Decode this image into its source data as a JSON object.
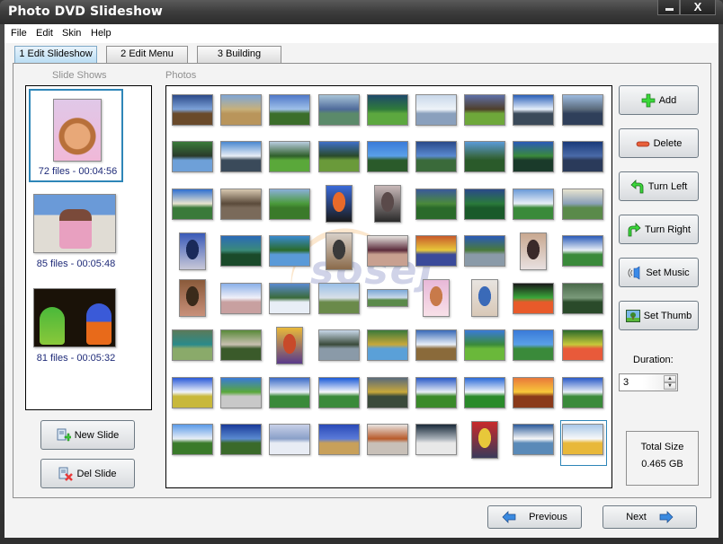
{
  "window": {
    "title": "Photo DVD Slideshow",
    "minimize_label": "",
    "close_label": "X"
  },
  "menu": {
    "items": [
      {
        "label": "File"
      },
      {
        "label": "Edit"
      },
      {
        "label": "Skin"
      },
      {
        "label": "Help"
      }
    ]
  },
  "tabs": [
    {
      "label": "1 Edit Slideshow",
      "active": true
    },
    {
      "label": "2 Edit Menu",
      "active": false
    },
    {
      "label": "3 Building",
      "active": false
    }
  ],
  "slideshows": {
    "heading": "Slide Shows",
    "items": [
      {
        "caption": "72 files - 00:04:56",
        "thumb": "girl-portrait",
        "selected": true
      },
      {
        "caption": "85 files - 00:05:48",
        "thumb": "couple-beach",
        "selected": false
      },
      {
        "caption": "81 files - 00:05:32",
        "thumb": "parrots",
        "selected": false
      }
    ],
    "new_slide_label": "New Slide",
    "del_slide_label": "Del Slide"
  },
  "photos": {
    "heading": "Photos",
    "watermark": "sosej",
    "selected_index": 71,
    "items": [
      {
        "subject": "windmill-field",
        "orient": "h",
        "colors": [
          "#2b4a8a",
          "#7da2d8",
          "#6a4a2a"
        ]
      },
      {
        "subject": "dry-field",
        "orient": "h",
        "colors": [
          "#7fa6d6",
          "#c7b07a",
          "#b9955b"
        ]
      },
      {
        "subject": "green-field-sky",
        "orient": "h",
        "colors": [
          "#4f78c9",
          "#9fc0e8",
          "#3b6e2a"
        ]
      },
      {
        "subject": "bridge",
        "orient": "h",
        "colors": [
          "#a8c4d8",
          "#4e6a9a",
          "#5b8a6a"
        ]
      },
      {
        "subject": "hill-tree",
        "orient": "h",
        "colors": [
          "#1e4a6a",
          "#2f7a3a",
          "#5ca83f"
        ]
      },
      {
        "subject": "snow-landscape",
        "orient": "h",
        "colors": [
          "#c9d8ea",
          "#eef3f8",
          "#8aa0bd"
        ]
      },
      {
        "subject": "meadow-trees",
        "orient": "h",
        "colors": [
          "#5e6fa8",
          "#4f3f2a",
          "#6ea83a"
        ]
      },
      {
        "subject": "clouds-sea",
        "orient": "h",
        "colors": [
          "#2a5fb8",
          "#e7f0fb",
          "#3b4a5a"
        ]
      },
      {
        "subject": "lone-tree",
        "orient": "h",
        "colors": [
          "#9dbbe0",
          "#5a6a7a",
          "#2f3f5a"
        ]
      },
      {
        "subject": "coast-cliff",
        "orient": "h",
        "colors": [
          "#3a7a3a",
          "#2a3a2a",
          "#6ea0d8"
        ]
      },
      {
        "subject": "cloudy-sky",
        "orient": "h",
        "colors": [
          "#4a88d0",
          "#e8eef6",
          "#3a4a5a"
        ]
      },
      {
        "subject": "big-tree",
        "orient": "h",
        "colors": [
          "#b9cce0",
          "#2f5f2a",
          "#5aa83a"
        ]
      },
      {
        "subject": "tree-blue-sky",
        "orient": "h",
        "colors": [
          "#3f6fc8",
          "#2a4a2a",
          "#6a9a3a"
        ]
      },
      {
        "subject": "palm-blue",
        "orient": "h",
        "colors": [
          "#3a7ad8",
          "#5aa0e8",
          "#2a5a2a"
        ]
      },
      {
        "subject": "lake-mountain",
        "orient": "h",
        "colors": [
          "#2a4a8a",
          "#5a8ad0",
          "#3a6a3a"
        ]
      },
      {
        "subject": "volcano",
        "orient": "h",
        "colors": [
          "#5a9ad8",
          "#3a6a4a",
          "#2a5a2a"
        ]
      },
      {
        "subject": "tropical",
        "orient": "h",
        "colors": [
          "#2a5ab8",
          "#3a8a3a",
          "#1a3a2a"
        ]
      },
      {
        "subject": "dark-lake",
        "orient": "h",
        "colors": [
          "#1a3a7a",
          "#4a6aa8",
          "#2a3a5a"
        ]
      },
      {
        "subject": "palm-beach",
        "orient": "h",
        "colors": [
          "#2f6fd0",
          "#e8e4d0",
          "#3a7a3a"
        ]
      },
      {
        "subject": "sunset-plain",
        "orient": "h",
        "colors": [
          "#d8c8b0",
          "#5a4a3a",
          "#7a6a5a"
        ]
      },
      {
        "subject": "green-plain",
        "orient": "h",
        "colors": [
          "#8ab0d8",
          "#4a9a3a",
          "#3a7a2a"
        ]
      },
      {
        "subject": "kids-orange",
        "orient": "v",
        "colors": [
          "#3a6ad8",
          "#e86a2a",
          "#1a1a1a"
        ]
      },
      {
        "subject": "family-group",
        "orient": "v",
        "colors": [
          "#c8b8b8",
          "#5a4a4a",
          "#2a2a2a"
        ]
      },
      {
        "subject": "hills-sky",
        "orient": "h",
        "colors": [
          "#3a5a9a",
          "#4a8a3a",
          "#2a6a2a"
        ]
      },
      {
        "subject": "green-hills",
        "orient": "h",
        "colors": [
          "#2a4a8a",
          "#2a7a3a",
          "#1a5a2a"
        ]
      },
      {
        "subject": "tree-clouds",
        "orient": "h",
        "colors": [
          "#6a9ad8",
          "#e8eef6",
          "#3a8a3a"
        ]
      },
      {
        "subject": "misty-hills",
        "orient": "h",
        "colors": [
          "#e8e4d0",
          "#8aa0b8",
          "#5a8a4a"
        ]
      },
      {
        "subject": "child-blue",
        "orient": "v",
        "colors": [
          "#3a5ab8",
          "#1a2a5a",
          "#c8c8d8"
        ]
      },
      {
        "subject": "lagoon",
        "orient": "h",
        "colors": [
          "#2a6ab8",
          "#3a8a7a",
          "#1a4a2a"
        ]
      },
      {
        "subject": "coast-tree",
        "orient": "h",
        "colors": [
          "#3a8ad0",
          "#2a6a2a",
          "#5a9ad8"
        ]
      },
      {
        "subject": "boy-portrait",
        "orient": "v",
        "colors": [
          "#d8d0c8",
          "#3a3a3a",
          "#8a6a4a"
        ]
      },
      {
        "subject": "twins-portrait",
        "orient": "h",
        "colors": [
          "#e8e4e0",
          "#5a2a3a",
          "#c8a090"
        ]
      },
      {
        "subject": "kids-colorful",
        "orient": "h",
        "colors": [
          "#c85a2a",
          "#e8c83a",
          "#3a4a9a"
        ]
      },
      {
        "subject": "river-valley",
        "orient": "h",
        "colors": [
          "#2a5ab8",
          "#4a7a3a",
          "#8a9aa8"
        ]
      },
      {
        "subject": "cow-portrait",
        "orient": "v",
        "colors": [
          "#c8a890",
          "#3a2a2a",
          "#e8e0e0"
        ]
      },
      {
        "subject": "tree-horizon",
        "orient": "h",
        "colors": [
          "#2a5ab8",
          "#e8eef6",
          "#3a8a3a"
        ]
      },
      {
        "subject": "couple-portrait",
        "orient": "v",
        "colors": [
          "#8a5a3a",
          "#3a2a1a",
          "#c8907a"
        ]
      },
      {
        "subject": "mt-fuji",
        "orient": "h",
        "colors": [
          "#8ab0e8",
          "#f0f0f8",
          "#c8a0a0"
        ]
      },
      {
        "subject": "mountain-valley",
        "orient": "h",
        "colors": [
          "#5a8ad0",
          "#3a6a3a",
          "#e8eef6"
        ]
      },
      {
        "subject": "plain-sky",
        "orient": "h",
        "colors": [
          "#9ac0e8",
          "#d8e0e8",
          "#6a8a4a"
        ]
      },
      {
        "subject": "wide-panorama",
        "orient": "h",
        "colors": [
          "#7aa8d8",
          "#c8d8e8",
          "#5a8a4a"
        ]
      },
      {
        "subject": "girl-princess",
        "orient": "v",
        "colors": [
          "#e8b8d8",
          "#c87a4a",
          "#f8e0e8"
        ]
      },
      {
        "subject": "girl-blue-dress",
        "orient": "v",
        "colors": [
          "#e8e4e0",
          "#3a6ab8",
          "#d8c8b8"
        ]
      },
      {
        "subject": "parrots",
        "orient": "h",
        "colors": [
          "#1a1a1a",
          "#3aa83a",
          "#e85a2a"
        ]
      },
      {
        "subject": "green-pond",
        "orient": "h",
        "colors": [
          "#4a6a4a",
          "#7a9a7a",
          "#2a4a2a"
        ]
      },
      {
        "subject": "tent-camp",
        "orient": "h",
        "colors": [
          "#5a7a5a",
          "#2a8a8a",
          "#8aaa6a"
        ]
      },
      {
        "subject": "road-walkers",
        "orient": "h",
        "colors": [
          "#5a8a3a",
          "#c8c0b0",
          "#3a5a2a"
        ]
      },
      {
        "subject": "girl-orange-dress",
        "orient": "v",
        "colors": [
          "#e8b83a",
          "#c84a2a",
          "#5a3a8a"
        ]
      },
      {
        "subject": "waterfall",
        "orient": "h",
        "colors": [
          "#c8d8e8",
          "#3a4a3a",
          "#8a9aa8"
        ]
      },
      {
        "subject": "hillside",
        "orient": "h",
        "colors": [
          "#3a7a3a",
          "#c8a83a",
          "#5aa0d8"
        ]
      },
      {
        "subject": "plane-field",
        "orient": "h",
        "colors": [
          "#3a6ab8",
          "#e8eef6",
          "#8a6a3a"
        ]
      },
      {
        "subject": "terraces",
        "orient": "h",
        "colors": [
          "#3a7ad8",
          "#3a8a3a",
          "#6ab83a"
        ]
      },
      {
        "subject": "house-hill",
        "orient": "h",
        "colors": [
          "#3a7ad8",
          "#5aa0e8",
          "#3a8a3a"
        ]
      },
      {
        "subject": "farm-field",
        "orient": "h",
        "colors": [
          "#2a6a2a",
          "#c8c83a",
          "#e85a3a"
        ]
      },
      {
        "subject": "clouds-field",
        "orient": "h",
        "colors": [
          "#2a5ad8",
          "#f0f4fa",
          "#c8b83a"
        ]
      },
      {
        "subject": "castle-field",
        "orient": "h",
        "colors": [
          "#3a7ad8",
          "#5aa83a",
          "#c8c8c8"
        ]
      },
      {
        "subject": "trees-clouds",
        "orient": "h",
        "colors": [
          "#3a6ac8",
          "#e8eef6",
          "#3a8a3a"
        ]
      },
      {
        "subject": "big-clouds",
        "orient": "h",
        "colors": [
          "#1a5ad8",
          "#f8f8fc",
          "#3a8a3a"
        ]
      },
      {
        "subject": "storm-field",
        "orient": "h",
        "colors": [
          "#5a6a7a",
          "#c8a83a",
          "#3a4a3a"
        ]
      },
      {
        "subject": "sky-field",
        "orient": "h",
        "colors": [
          "#2a5ac8",
          "#e8eef6",
          "#3a8a2a"
        ]
      },
      {
        "subject": "field-clouds",
        "orient": "h",
        "colors": [
          "#2a6ad8",
          "#f0f4fa",
          "#2a8a2a"
        ]
      },
      {
        "subject": "ocean-sunset",
        "orient": "h",
        "colors": [
          "#e8783a",
          "#f8c83a",
          "#8a3a1a"
        ]
      },
      {
        "subject": "blue-sky-hill",
        "orient": "h",
        "colors": [
          "#2a5ac8",
          "#e8eef6",
          "#3a8a3a"
        ]
      },
      {
        "subject": "green-hill",
        "orient": "h",
        "colors": [
          "#5a9ae8",
          "#e8eef6",
          "#3a7a2a"
        ]
      },
      {
        "subject": "deep-blue-sky",
        "orient": "h",
        "colors": [
          "#1a3a9a",
          "#5a8ad0",
          "#3a6a2a"
        ]
      },
      {
        "subject": "foggy-sea",
        "orient": "h",
        "colors": [
          "#c8d0e8",
          "#8aa0c8",
          "#e8ecf4"
        ]
      },
      {
        "subject": "blue-mountains",
        "orient": "h",
        "colors": [
          "#2a4ab8",
          "#5a7ad8",
          "#c8a05a"
        ]
      },
      {
        "subject": "red-rocks",
        "orient": "h",
        "colors": [
          "#e8e4e0",
          "#b85a2a",
          "#c8c0b8"
        ]
      },
      {
        "subject": "white-tiger",
        "orient": "h",
        "colors": [
          "#1a2a3a",
          "#a8b0b8",
          "#e8e8e8"
        ]
      },
      {
        "subject": "woman-red",
        "orient": "v",
        "colors": [
          "#c82a2a",
          "#e8c83a",
          "#3a3a5a"
        ]
      },
      {
        "subject": "swan",
        "orient": "h",
        "colors": [
          "#2a5a9a",
          "#f8f8f8",
          "#5a8ab8"
        ]
      },
      {
        "subject": "eagle",
        "orient": "h",
        "colors": [
          "#a8c8e8",
          "#f8f8f8",
          "#e8b83a"
        ]
      }
    ]
  },
  "actions": {
    "add": "Add",
    "delete": "Delete",
    "turn_left": "Turn Left",
    "turn_right": "Turn Right",
    "set_music": "Set Music",
    "set_thumb": "Set Thumb"
  },
  "duration": {
    "label": "Duration:",
    "value": "3"
  },
  "total_size": {
    "label": "Total Size",
    "value": "0.465 GB"
  },
  "nav": {
    "previous": "Previous",
    "next": "Next"
  },
  "colors": {
    "selection": "#2e86b8",
    "caption": "#1e2a78",
    "active_tab": "#b7dcf3"
  }
}
